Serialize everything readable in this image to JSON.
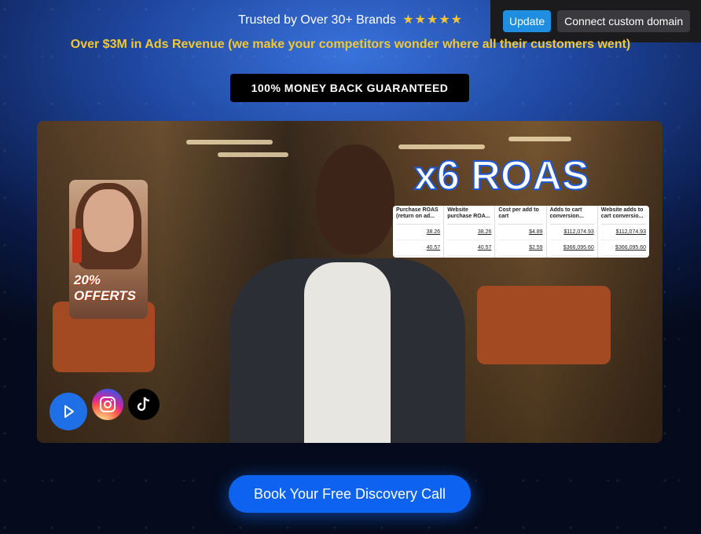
{
  "header": {
    "trusted_text": "Trusted by Over 30+ Brands",
    "stars": "★★★★★",
    "revenue_text": "Over $3M in Ads Revenue (we make your competitors wonder where all their customers went)",
    "guarantee_label": "100% MONEY BACK GUARANTEED"
  },
  "editor_bar": {
    "update_label": "Update",
    "domain_label": "Connect custom domain"
  },
  "video": {
    "overlay_title": "x6 ROAS",
    "promo_text": "20% OFFERTS",
    "stats_table": {
      "headers": [
        "Purchase ROAS (return on ad...",
        "Website purchase ROA...",
        "Cost per add to cart",
        "Adds to cart conversion...",
        "Website adds to cart conversio..."
      ],
      "rows": [
        [
          "38.26",
          "38.26",
          "$4.89",
          "$112,074.93",
          "$112,074.93"
        ],
        [
          "40.57",
          "40.57",
          "$2.59",
          "$366,095.60",
          "$366,095.60"
        ]
      ]
    },
    "social_icons": [
      "play-icon",
      "instagram-icon",
      "tiktok-icon"
    ]
  },
  "cta": {
    "label": "Book Your Free Discovery Call"
  },
  "colors": {
    "accent_blue": "#0d63f0",
    "gold": "#f2c832",
    "editor_update": "#1f8ee0"
  }
}
